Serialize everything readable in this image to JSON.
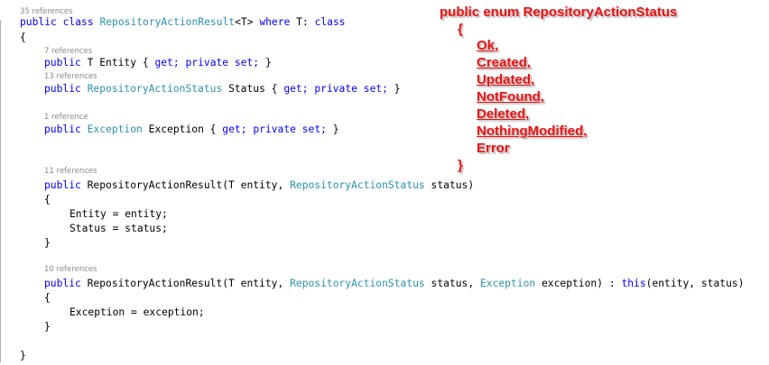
{
  "code": {
    "class_refs": "35 references",
    "class_decl": {
      "kw_public": "public",
      "kw_class": "class",
      "type_name": "RepositoryActionResult",
      "generic": "<T>",
      "kw_where": "where",
      "constraint": "T:",
      "kw_class2": "class"
    },
    "open_brace": "{",
    "close_brace": "}",
    "entity_refs": "7 references",
    "entity_prop": {
      "kw_public": "public",
      "rest_a": "T Entity {",
      "kw_get": "get;",
      "kw_private": "private",
      "kw_set": "set;",
      "rest_b": "}"
    },
    "status_refs": "13 references",
    "status_prop": {
      "kw_public": "public",
      "type": "RepositoryActionStatus",
      "rest_a": "Status {",
      "kw_get": "get;",
      "kw_private": "private",
      "kw_set": "set;",
      "rest_b": "}"
    },
    "exception_refs": "1 reference",
    "exception_prop": {
      "kw_public": "public",
      "type": "Exception",
      "rest_a": "Exception {",
      "kw_get": "get;",
      "kw_private": "private",
      "kw_set": "set;",
      "rest_b": "}"
    },
    "ctor1_refs": "11 references",
    "ctor1": {
      "kw_public": "public",
      "sig_a": "RepositoryActionResult(T entity,",
      "type": "RepositoryActionStatus",
      "sig_b": "status)"
    },
    "ctor1_body": [
      "Entity = entity;",
      "Status = status;"
    ],
    "ctor2_refs": "10 references",
    "ctor2": {
      "kw_public": "public",
      "sig_a": "RepositoryActionResult(T entity,",
      "type": "RepositoryActionStatus",
      "sig_b": "status,",
      "type2": "Exception",
      "sig_c": "exception) :",
      "kw_this": "this",
      "sig_d": "(entity, status)"
    },
    "ctor2_body": [
      "Exception = exception;"
    ]
  },
  "annotation": {
    "header": "public enum RepositoryActionStatus",
    "open_brace": "{",
    "members": [
      "Ok,",
      "Created,",
      "Updated,",
      "NotFound,",
      "Deleted,",
      "NothingModified,",
      "Error"
    ],
    "close_brace": "}"
  },
  "colors": {
    "keyword": "#0000ff",
    "type": "#2b91af",
    "codelens": "#8a8a8a",
    "annotation": "#ee1111"
  }
}
